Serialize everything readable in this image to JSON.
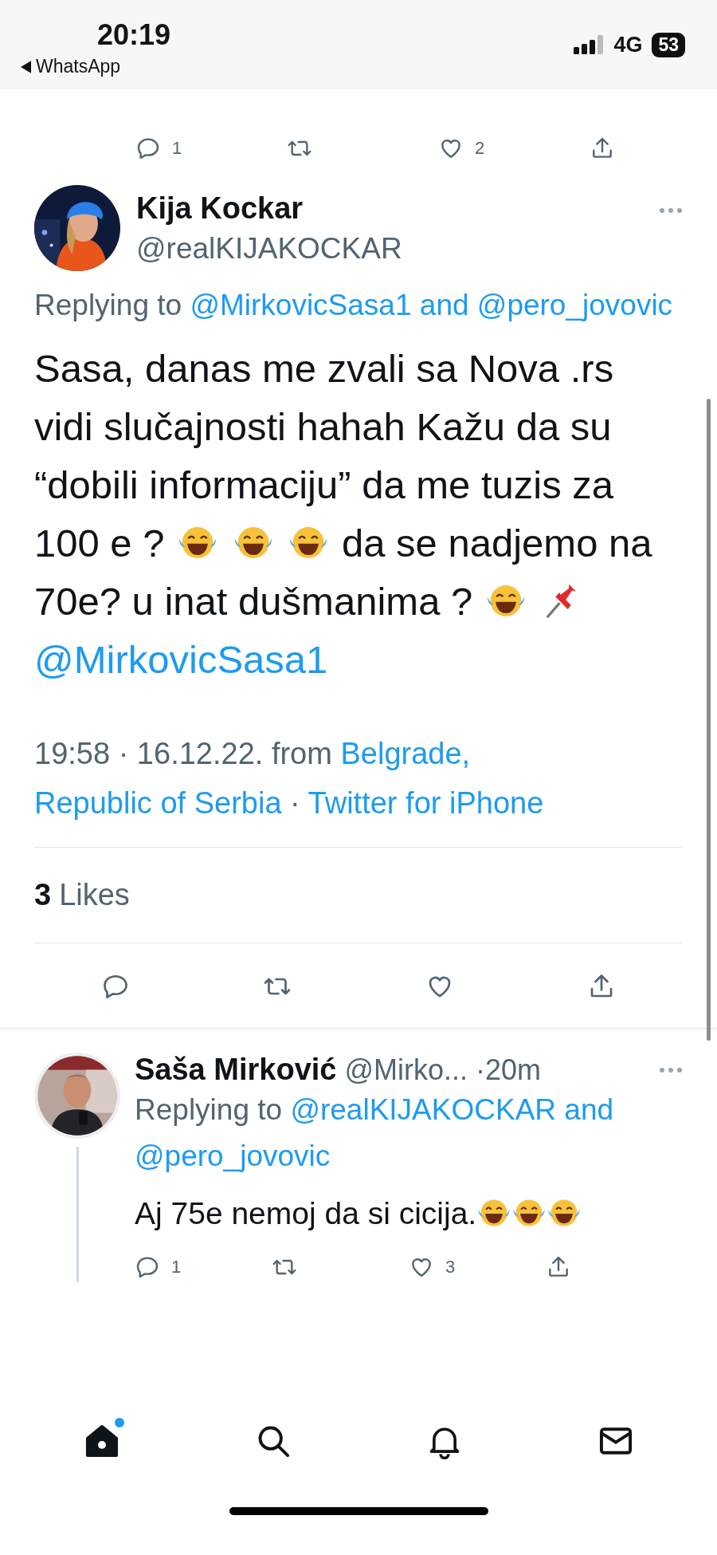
{
  "status_bar": {
    "time": "20:19",
    "back_app": "WhatsApp",
    "network": "4G",
    "battery": "53"
  },
  "previous_tweet_actions": {
    "replies": "1",
    "likes": "2"
  },
  "tweet": {
    "name": "Kija Kockar",
    "handle": "@realKIJAKOCKAR",
    "replying": [
      {
        "kind": "plain",
        "text": "Replying to"
      },
      {
        "kind": "link",
        "text": "@MirkovicSasa1"
      },
      {
        "kind": "link",
        "text": "and"
      },
      {
        "kind": "link",
        "text": "@pero_jovovic"
      }
    ],
    "body": [
      {
        "kind": "text",
        "text": "Sasa, danas me zvali sa Nova .rs vidi slučajnosti hahah Kažu da su “dobili informaciju”  da me tuzis za 100 e ?"
      },
      {
        "kind": "laugh"
      },
      {
        "kind": "laugh"
      },
      {
        "kind": "laugh"
      },
      {
        "kind": "text",
        "text": "da se nadjemo na 70e?  u inat dušmanima ?"
      },
      {
        "kind": "laugh"
      },
      {
        "kind": "pin"
      },
      {
        "kind": "mention",
        "text": "@MirkovicSasa1"
      }
    ],
    "meta": [
      {
        "kind": "plain",
        "text": "19:58 · 16.12.22. from"
      },
      {
        "kind": "link",
        "text": "Belgrade,"
      },
      {
        "kind": "link",
        "text": "Republic of Serbia"
      },
      {
        "kind": "plain",
        "text": "·"
      },
      {
        "kind": "link",
        "text": "Twitter for iPhone"
      }
    ],
    "likes_count": "3",
    "likes_label": "Likes"
  },
  "reply": {
    "name": "Saša Mirković",
    "handle": "@Mirko...",
    "time": "·20m",
    "replying": [
      {
        "kind": "plain",
        "text": "Replying to"
      },
      {
        "kind": "link",
        "text": "@realKIJAKOCKAR"
      },
      {
        "kind": "link",
        "text": "and"
      },
      {
        "kind": "link",
        "text": "@pero_jovovic"
      }
    ],
    "body": [
      {
        "kind": "text",
        "text": "Aj 75e nemoj da si cicija."
      },
      {
        "kind": "laugh"
      },
      {
        "kind": "laugh"
      },
      {
        "kind": "laugh"
      }
    ],
    "replies": "1",
    "likes": "3"
  },
  "tab_bar": [
    {
      "kind": "home",
      "selected": true,
      "badge": true
    },
    {
      "kind": "search",
      "selected": false,
      "badge": false
    },
    {
      "kind": "bell",
      "selected": false,
      "badge": false
    },
    {
      "kind": "mail",
      "selected": false,
      "badge": false
    }
  ]
}
